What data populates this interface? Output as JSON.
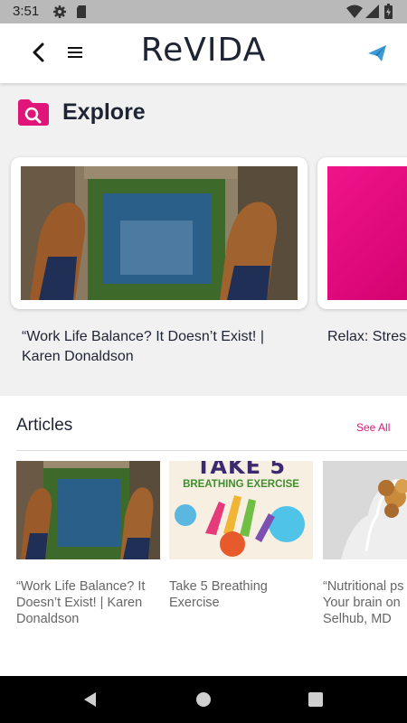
{
  "status_bar": {
    "time": "3:51",
    "icons": [
      "settings-icon",
      "sd-card-icon",
      "wifi-icon",
      "signal-icon",
      "battery-icon"
    ]
  },
  "app_bar": {
    "logo": "ReVIDA",
    "icons": [
      "back-arrow-icon",
      "hamburger-menu-icon",
      "send-icon"
    ],
    "accent_color": "#e0157a",
    "send_color": "#3a9bd6"
  },
  "explore": {
    "title": "Explore",
    "cards": [
      {
        "caption": "“Work Life Balance? It Doesn’t Exist! | Karen Donaldson"
      },
      {
        "caption": "Relax: Stress"
      }
    ]
  },
  "articles": {
    "title": "Articles",
    "see_all": "See All",
    "items": [
      {
        "caption": "“Work Life Balance? It Doesn’t Exist! | Karen Donaldson"
      },
      {
        "caption": "Take 5 Breathing Exercise",
        "image_text": [
          "TAKE 5",
          "BREATHING EXERCISE"
        ]
      },
      {
        "caption": "“Nutritional ps… Your brain on … Selhub, MD",
        "lines": [
          "“Nutritional ps",
          "Your brain on",
          "Selhub, MD"
        ]
      }
    ]
  },
  "nav_bar": {
    "buttons": [
      "back-triangle-icon",
      "home-circle-icon",
      "recents-square-icon"
    ]
  }
}
